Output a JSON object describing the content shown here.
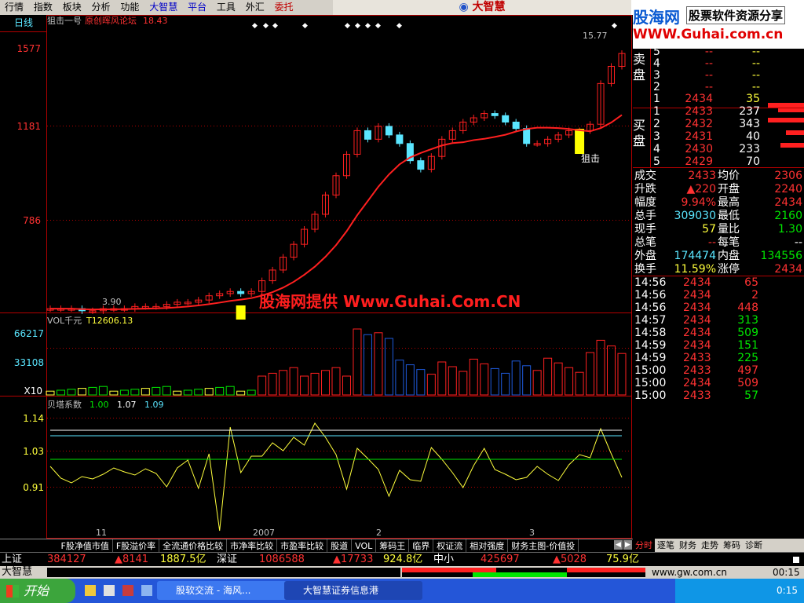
{
  "menu": [
    "行情",
    "指数",
    "板块",
    "分析",
    "功能",
    "大智慧",
    "平台",
    "工具",
    "外汇",
    "委托"
  ],
  "brand_title": "大智慧",
  "logo": {
    "name": "股海网",
    "slogan": "股票软件资源分享",
    "url": "WWW.Guhai.com.cn"
  },
  "chart": {
    "period_label": "日线",
    "indicator_title": "狙击一号",
    "indicator_sub": "原创晖风论坛",
    "indicator_value": "18.43",
    "price_ticks": [
      "1577",
      "1181",
      "786"
    ],
    "hi_label": "15.77",
    "lo_label": "3.90",
    "signal_label": "狙击",
    "watermark": "股海网提供 Www.Guhai.Com.CN",
    "vol_title": "VOL千元",
    "vol_value": "T12606.13",
    "vol_ticks": [
      "66217",
      "33108",
      "X10"
    ],
    "beta_title": "贝塔系数",
    "beta_vals": [
      "1.00",
      "1.07",
      "1.09"
    ],
    "beta_ticks": [
      "1.14",
      "1.03",
      "0.91"
    ],
    "x_ticks": [
      "11",
      "2007",
      "2",
      "3"
    ]
  },
  "chart_data": {
    "type": "candlestick",
    "closes": [
      3.9,
      3.9,
      3.9,
      3.8,
      3.8,
      3.9,
      3.9,
      3.9,
      4.0,
      4.0,
      4.0,
      4.1,
      4.2,
      4.2,
      4.3,
      4.5,
      4.6,
      4.7,
      4.6,
      4.7,
      5.2,
      5.7,
      6.3,
      6.9,
      7.6,
      8.3,
      9.2,
      10.1,
      11.1,
      12.2,
      11.8,
      12.4,
      12.0,
      11.6,
      10.8,
      10.4,
      11.0,
      11.8,
      12.2,
      12.6,
      12.8,
      13.0,
      12.9,
      12.6,
      12.3,
      11.6,
      11.6,
      11.8,
      12.0,
      12.2,
      12.2,
      12.5,
      14.4,
      15.2,
      15.8
    ],
    "ma_ylim": [
      3.5,
      16.5
    ]
  },
  "right_panel": {
    "sell_label": "卖盘",
    "buy_label": "买盘",
    "sell": [
      [
        "5",
        "--",
        "--"
      ],
      [
        "4",
        "--",
        "--"
      ],
      [
        "3",
        "--",
        "--"
      ],
      [
        "2",
        "--",
        "--"
      ],
      [
        "1",
        "2434",
        "35"
      ]
    ],
    "buy": [
      [
        "1",
        "2433",
        "237"
      ],
      [
        "2",
        "2432",
        "343"
      ],
      [
        "3",
        "2431",
        "40"
      ],
      [
        "4",
        "2430",
        "233"
      ],
      [
        "5",
        "2429",
        "70"
      ]
    ],
    "stats": [
      [
        "成交",
        "2433",
        "均价",
        "2306"
      ],
      [
        "升跌",
        "▲220",
        "开盘",
        "2240"
      ],
      [
        "幅度",
        "9.94%",
        "最高",
        "2434"
      ],
      [
        "总手",
        "309030",
        "最低",
        "2160"
      ],
      [
        "现手",
        "57",
        "量比",
        "1.30"
      ],
      [
        "总笔",
        "--",
        "每笔",
        "--"
      ],
      [
        "外盘",
        "174474",
        "内盘",
        "134556"
      ],
      [
        "换手",
        "11.59%",
        "涨停",
        "2434"
      ]
    ],
    "ticks": [
      [
        "14:56",
        "2434",
        "65"
      ],
      [
        "14:56",
        "2434",
        "2"
      ],
      [
        "14:56",
        "2434",
        "448"
      ],
      [
        "14:57",
        "2434",
        "313"
      ],
      [
        "14:58",
        "2434",
        "509"
      ],
      [
        "14:59",
        "2434",
        "151"
      ],
      [
        "14:59",
        "2433",
        "225"
      ],
      [
        "15:00",
        "2433",
        "497"
      ],
      [
        "15:00",
        "2434",
        "509"
      ],
      [
        "15:00",
        "2433",
        "57"
      ]
    ]
  },
  "bottom_tabs": [
    "F股净值市值",
    "F股溢价率",
    "全流通价格比较",
    "市净率比较",
    "市盈率比较",
    "股道",
    "VOL",
    "筹码王",
    "临界",
    "权证流",
    "相对强度",
    "财务主图-价值投"
  ],
  "right_tabs": [
    "分时",
    "逐笔",
    "财务",
    "走势",
    "筹码",
    "诊断"
  ],
  "ticker": {
    "sh_label": "上证",
    "sh_vol": "384127",
    "sh_chg": "▲8141",
    "sh_amt": "1887.5亿",
    "sz_label": "深证",
    "sz_vol": "1086588",
    "sz_chg": "▲17733",
    "sz_amt": "924.8亿",
    "zx_label": "中小",
    "zx_vol": "425697",
    "zx_chg": "▲5028",
    "zx_amt": "75.9亿"
  },
  "status": {
    "app": "大智慧",
    "site": "www.gw.com.cn",
    "time": "00:15"
  },
  "taskbar": {
    "start": "开始",
    "task1": "股软交流 - 海风...",
    "task2": "大智慧证券信息港",
    "clock": "0:15"
  }
}
